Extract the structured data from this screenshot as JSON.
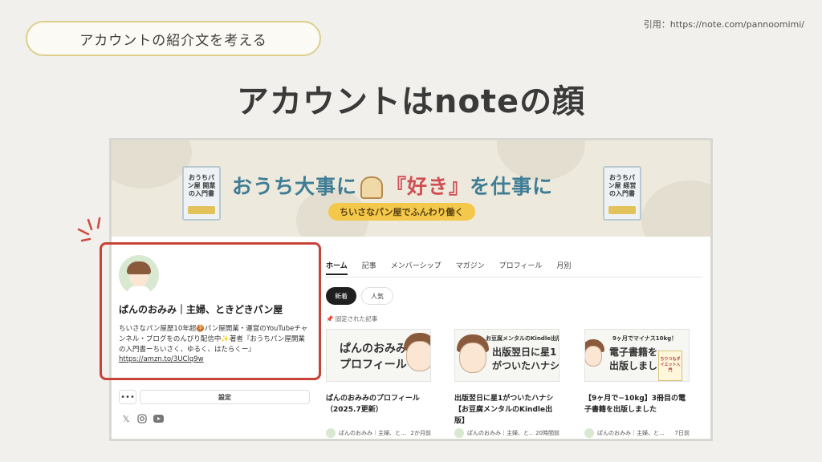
{
  "header": {
    "pill_label": "アカウントの紹介文を考える",
    "citation": "引用：https://note.com/pannoomimi/",
    "headline": "アカウントはnoteの顔"
  },
  "banner": {
    "title_pre": "おうち大事に",
    "title_quote_open": "『",
    "title_keyword": "好き",
    "title_quote_close": "』",
    "title_post": "を仕事に",
    "subtitle": "ちいさなパン屋でふんわり働く",
    "book_left_title": "おうちパン屋 開業の入門書",
    "book_right_title": "おうちパン屋 経営の入門書"
  },
  "profile": {
    "name": "ぱんのおみみ｜主婦、ときどきパン屋",
    "bio": "ちいさなパン屋歴10年超🍪パン屋開業・運営のYouTubeチャンネル・ブログをのんびり配信中✨著者『おうちパン屋開業の入門書ーちいさく、ゆるく、はたらくー』",
    "link": "https://amzn.to/3UClq9w",
    "more_label": "•••",
    "settings_label": "設定",
    "social": [
      "x-icon",
      "instagram-icon",
      "youtube-icon"
    ]
  },
  "tabs": [
    "ホーム",
    "記事",
    "メンバーシップ",
    "マガジン",
    "プロフィール",
    "月別"
  ],
  "filters": {
    "new": "新着",
    "popular": "人気"
  },
  "pinned_label": "固定された記事",
  "articles": [
    {
      "thumb_text": "ぱんのおみみの\nプロフィール",
      "title": "ぱんのおみみのプロフィール（2025.7更新）",
      "author": "ぱんのおみみ｜主婦、と...",
      "time": "2か月前"
    },
    {
      "thumb_small": "お豆腐メンタルのKindle出版",
      "thumb_text": "出版翌日に星1\nがついたハナシ",
      "title": "出版翌日に星1がついたハナシ【お豆腐メンタルのKindle出版】",
      "author": "ぱんのおみみ｜主婦、と...",
      "time": "20時間前"
    },
    {
      "thumb_small": "9ヶ月でマイナス10kg！",
      "thumb_text": "電子書籍を\n出版しました",
      "book_label": "ちりつもダイエット入門",
      "title": "【9ヶ月で−10kg】3冊目の電子書籍を出版しました",
      "author": "ぱんのおみみ｜主婦、と...",
      "time": "7日前"
    }
  ],
  "colors": {
    "background": "#f2f0ec",
    "pill_border": "#dccf8e",
    "highlight_box": "#c74338",
    "banner_title": "#3f7d95",
    "banner_keyword": "#d04e55",
    "banner_ribbon": "#f4c84a"
  }
}
